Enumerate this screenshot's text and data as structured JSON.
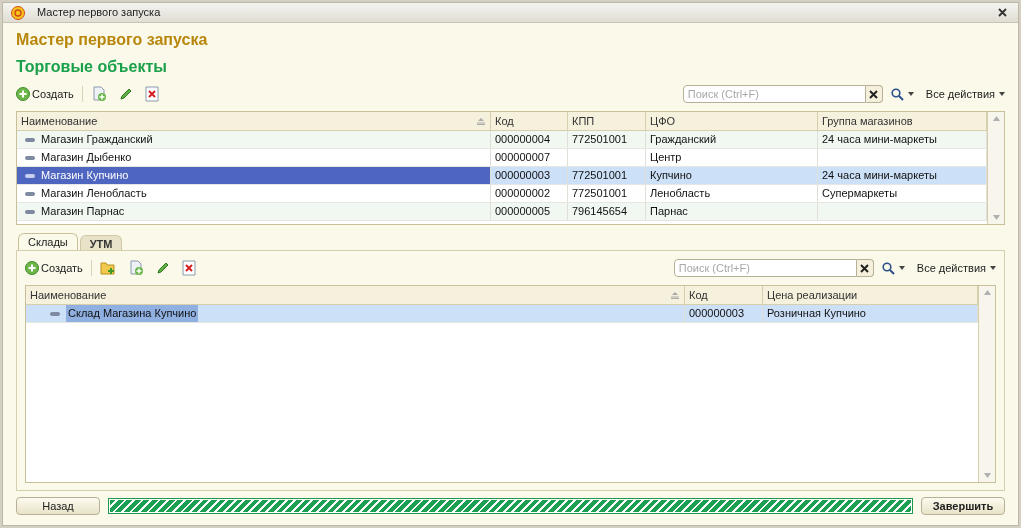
{
  "window": {
    "title": "Мастер первого запуска"
  },
  "heading": "Мастер первого запуска",
  "section": "Торговые объекты",
  "stores": {
    "create": "Создать",
    "search_placeholder": "Поиск (Ctrl+F)",
    "all_actions": "Все действия",
    "columns": [
      "Наименование",
      "Код",
      "КПП",
      "ЦФО",
      "Группа магазинов"
    ],
    "rows": [
      {
        "cells": [
          "Магазин Гражданский",
          "000000004",
          "772501001",
          "Гражданский",
          "24 часа мини-маркеты"
        ],
        "selected": false
      },
      {
        "cells": [
          "Магазин Дыбенко",
          "000000007",
          "",
          "Центр",
          ""
        ],
        "selected": false
      },
      {
        "cells": [
          "Магазин Купчино",
          "000000003",
          "772501001",
          "Купчино",
          "24 часа мини-маркеты"
        ],
        "selected": true
      },
      {
        "cells": [
          "Магазин Ленобласть",
          "000000002",
          "772501001",
          "Ленобласть",
          "Супермаркеты"
        ],
        "selected": false
      },
      {
        "cells": [
          "Магазин Парнас",
          "000000005",
          "796145654",
          "Парнас",
          ""
        ],
        "selected": false
      }
    ]
  },
  "tabs": [
    {
      "label": "Склады",
      "selected": true
    },
    {
      "label": "УТМ",
      "selected": false
    }
  ],
  "warehouses": {
    "create": "Создать",
    "search_placeholder": "Поиск (Ctrl+F)",
    "all_actions": "Все действия",
    "columns": [
      "Наименование",
      "Код",
      "Цена реализации"
    ],
    "rows": [
      {
        "cells": [
          "Склад Магазина Купчино",
          "000000003",
          "Розничная Купчино"
        ],
        "selected": true
      }
    ]
  },
  "footer": {
    "back": "Назад",
    "progress": {
      "level": 1
    },
    "finish": "Завершить"
  }
}
